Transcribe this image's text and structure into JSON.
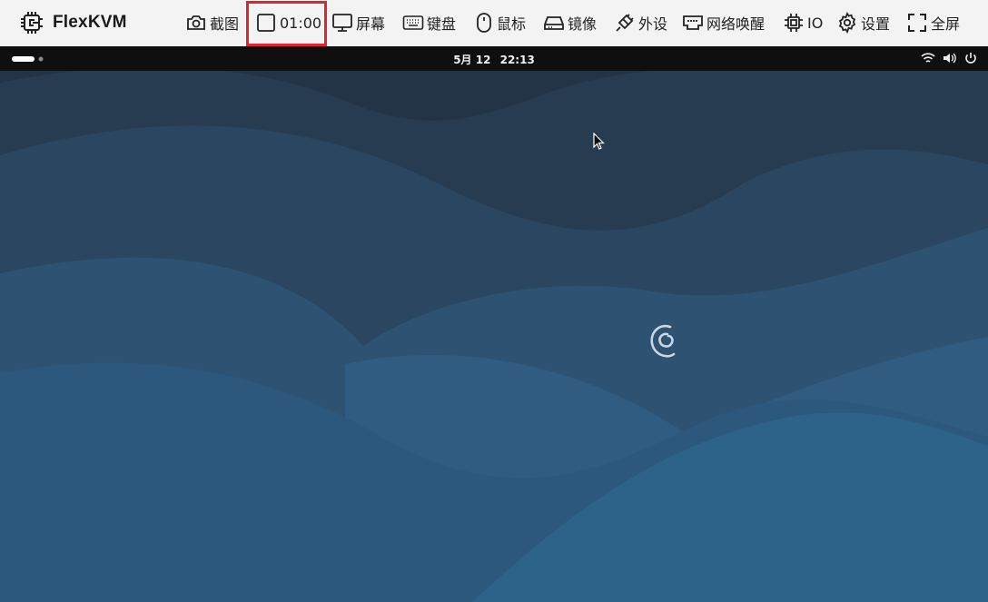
{
  "app": {
    "name": "FlexKVM",
    "logo_icon": "kvm-logo-icon"
  },
  "toolbar": {
    "screenshot": {
      "label": "截图",
      "icon": "camera-icon"
    },
    "record": {
      "label": "01:00",
      "icon": "record-stop-icon",
      "highlight_color": "#e1242f"
    },
    "screen": {
      "label": "屏幕",
      "icon": "monitor-icon"
    },
    "keyboard": {
      "label": "键盘",
      "icon": "keyboard-icon"
    },
    "mouse": {
      "label": "鼠标",
      "icon": "mouse-icon"
    },
    "image": {
      "label": "镜像",
      "icon": "drive-icon"
    },
    "peripheral": {
      "label": "外设",
      "icon": "plug-icon"
    },
    "wol": {
      "label": "网络唤醒",
      "icon": "network-card-icon"
    },
    "io": {
      "label": "IO",
      "icon": "chip-icon"
    },
    "settings": {
      "label": "设置",
      "icon": "gear-icon"
    },
    "fullscreen": {
      "label": "全屏",
      "icon": "fullscreen-icon"
    }
  },
  "remote_desktop": {
    "topbar": {
      "date": "5月 12",
      "time": "22:13"
    },
    "system_icons": [
      "wifi-icon",
      "volume-icon",
      "power-icon"
    ],
    "wallpaper_logo": "debian-swirl-icon",
    "colors": {
      "topbar": "#0f0f0f",
      "wallpaper_dark": "#223445",
      "wallpaper_light": "#2c5f86"
    }
  }
}
